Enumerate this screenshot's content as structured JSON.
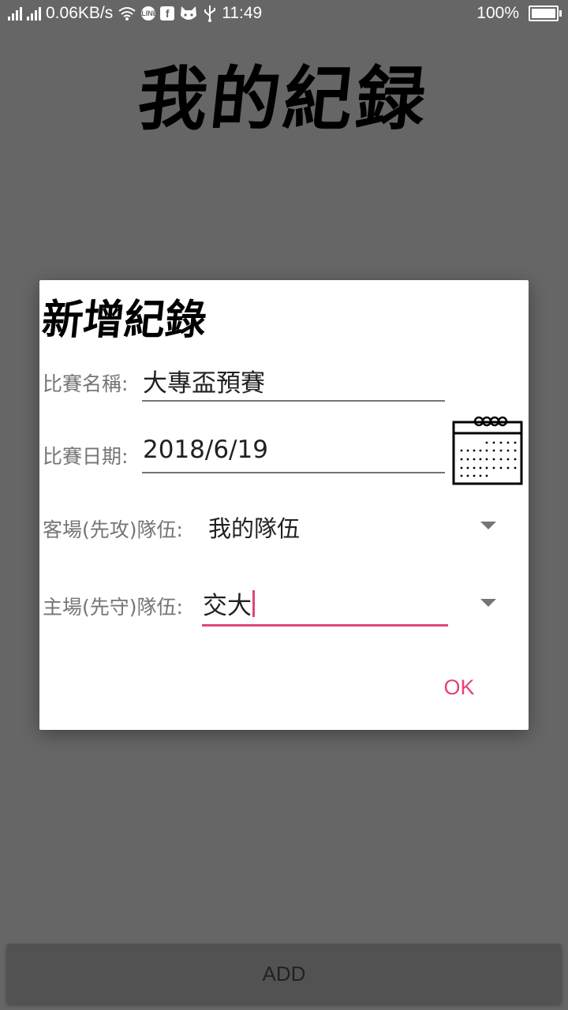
{
  "status_bar": {
    "net_speed": "0.06KB/s",
    "time": "11:49",
    "battery": "100%",
    "icons": [
      "signal-icon",
      "signal-icon",
      "wifi-icon",
      "line-icon",
      "facebook-icon",
      "cat-icon",
      "usb-icon",
      "battery-icon"
    ],
    "line_icon_text": "LINE",
    "facebook_icon_text": "f"
  },
  "app": {
    "title": "我的紀録"
  },
  "dialog": {
    "title": "新增紀錄",
    "match_name_label": "比賽名稱:",
    "match_name_value": "大專盃預賽",
    "match_date_label": "比賽日期:",
    "match_date_value": "2018/6/19",
    "away_team_label": "客場(先攻)隊伍:",
    "away_team_value": "我的隊伍",
    "home_team_label": "主場(先守)隊伍:",
    "home_team_value": "交大",
    "ok_label": "OK"
  },
  "add_button": {
    "label": "ADD"
  },
  "colors": {
    "accent": "#e0457b",
    "backdrop": "#666666",
    "dialog": "#ffffff"
  }
}
